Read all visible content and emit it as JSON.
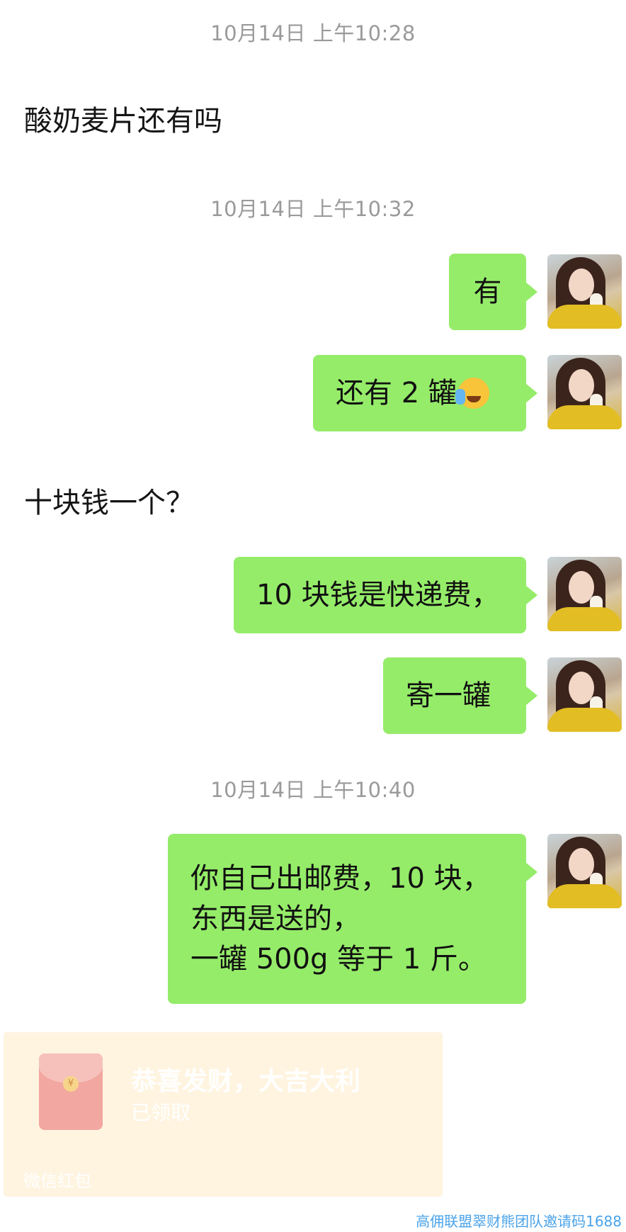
{
  "chat": {
    "timestamps": [
      "10月14日 上午10:28",
      "10月14日 上午10:32",
      "10月14日 上午10:40"
    ],
    "incoming": [
      "酸奶麦片还有吗",
      "十块钱一个？"
    ],
    "outgoing": [
      "有",
      "还有 2 罐",
      "10 块钱是快递费，",
      "寄一罐",
      "你自己出邮费，10 块，\n东西是送的，\n一罐 500g 等于 1 斤。"
    ],
    "emoji_after_2": "face-with-tears-of-joy"
  },
  "red_packet": {
    "title": "恭喜发财，大吉大利",
    "status": "已领取",
    "footer": "微信红包"
  },
  "watermark": "高佣联盟翠财熊团队邀请码1688",
  "colors": {
    "bubble": "#95ec69",
    "timestamp": "#9a9a9a",
    "red_packet_bg": "#fff4e0"
  }
}
